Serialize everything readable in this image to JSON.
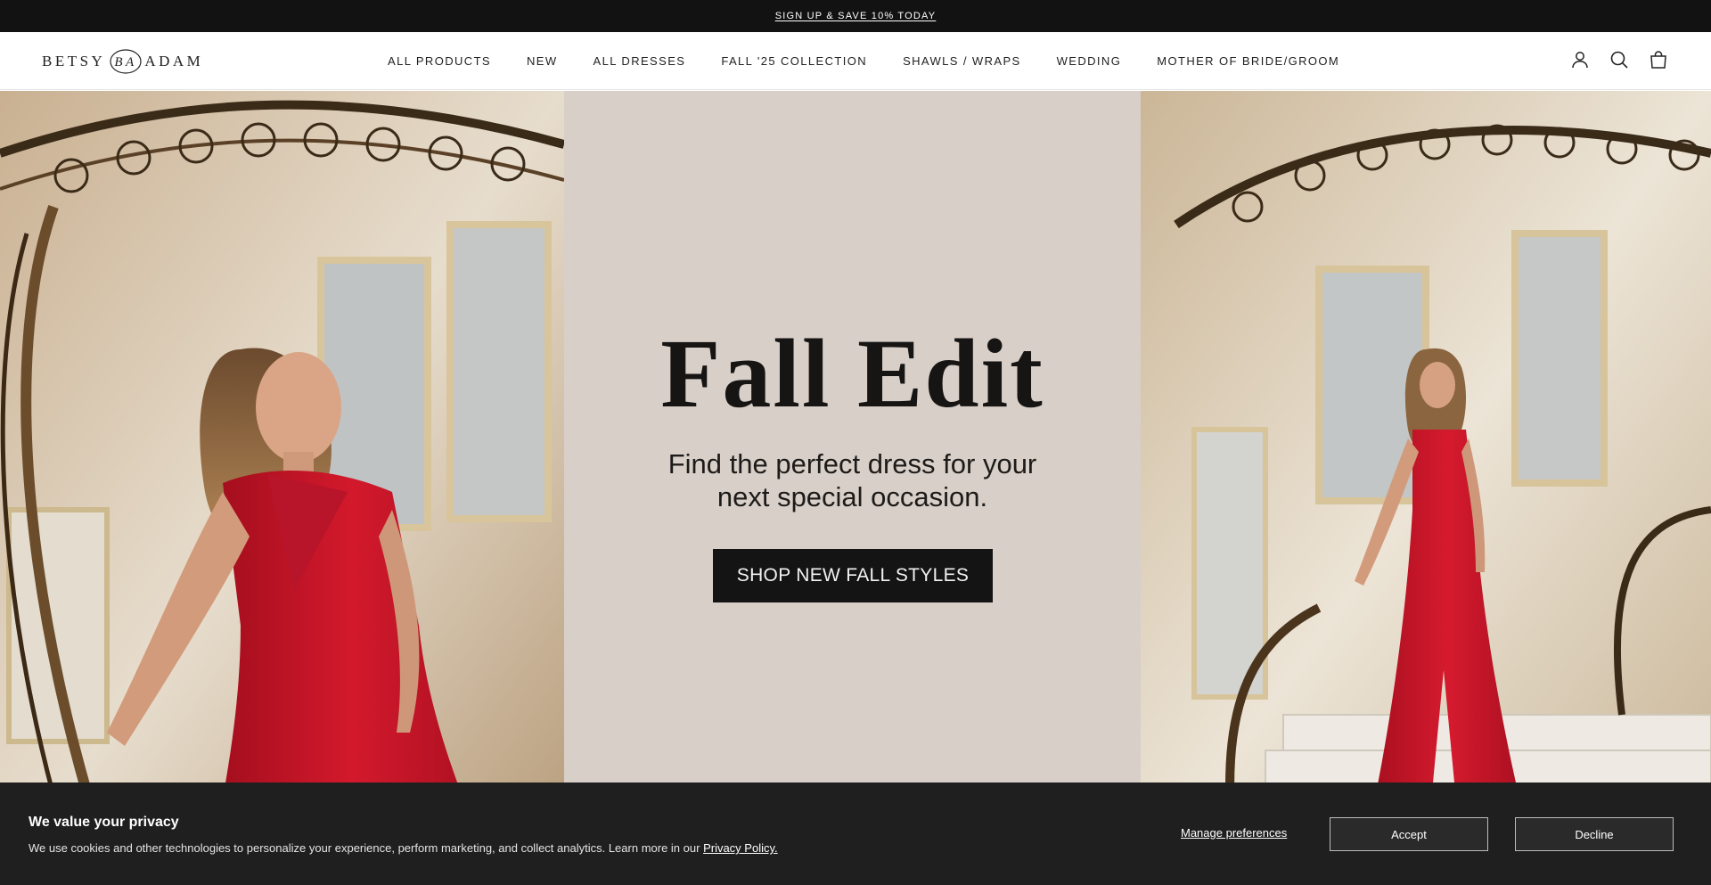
{
  "announcement": {
    "text": "SIGN UP & SAVE 10% TODAY"
  },
  "header": {
    "logo_left": "BETSY",
    "logo_monogram": "BA",
    "logo_right": "ADAM",
    "nav": [
      {
        "label": "ALL PRODUCTS"
      },
      {
        "label": "NEW"
      },
      {
        "label": "ALL DRESSES"
      },
      {
        "label": "FALL '25 COLLECTION"
      },
      {
        "label": "SHAWLS / WRAPS"
      },
      {
        "label": "WEDDING"
      },
      {
        "label": "MOTHER OF BRIDE/GROOM"
      }
    ],
    "icons": [
      "account-icon",
      "search-icon",
      "cart-icon"
    ]
  },
  "hero": {
    "title": "Fall Edit",
    "subtitle_line1": "Find the perfect dress for your",
    "subtitle_line2": "next special occasion.",
    "cta": "SHOP NEW FALL STYLES"
  },
  "cookie_banner": {
    "title": "We value your privacy",
    "body": "We use cookies and other technologies to personalize your experience, perform marketing, and collect analytics. Learn more in our ",
    "privacy_link": "Privacy Policy.",
    "manage": "Manage preferences",
    "accept": "Accept",
    "decline": "Decline"
  },
  "colors": {
    "announcement_bg": "#121212",
    "hero_center_bg": "#d8cfc8",
    "dress_red": "#c8102e",
    "cookie_bg": "#1f1f1f"
  }
}
